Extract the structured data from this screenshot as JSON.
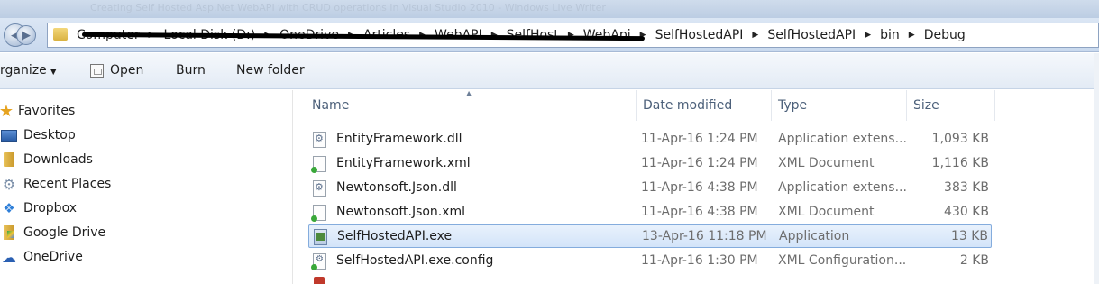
{
  "window": {
    "title": "Creating Self Hosted Asp.Net WebAPI with CRUD operations in Visual Studio 2010 - Windows Live Writer"
  },
  "address": {
    "crumbs_hidden": [
      "Computer",
      "Local Disk (D:)",
      "OneDrive",
      "Articles",
      "WebAPI",
      "SelfHost",
      "WebApi"
    ],
    "crumbs_visible": [
      "SelfHostedAPI",
      "SelfHostedAPI",
      "bin",
      "Debug"
    ]
  },
  "toolbar": {
    "organize": "rganize",
    "open": "Open",
    "burn": "Burn",
    "new_folder": "New folder"
  },
  "nav": {
    "items": [
      {
        "label": "Favorites",
        "icon": "star-icon"
      },
      {
        "label": "Desktop",
        "icon": "desktop-icon"
      },
      {
        "label": "Downloads",
        "icon": "downloads-folder-icon"
      },
      {
        "label": "Recent Places",
        "icon": "recent-places-icon"
      },
      {
        "label": "Dropbox",
        "icon": "dropbox-icon"
      },
      {
        "label": "Google Drive",
        "icon": "google-drive-icon"
      },
      {
        "label": "OneDrive",
        "icon": "onedrive-icon"
      }
    ]
  },
  "columns": {
    "name": "Name",
    "date": "Date modified",
    "type": "Type",
    "size": "Size"
  },
  "files": [
    {
      "name": "EntityFramework.dll",
      "date": "11-Apr-16 1:24 PM",
      "type": "Application extens...",
      "size": "1,093 KB",
      "icon": "dll-file-icon"
    },
    {
      "name": "EntityFramework.xml",
      "date": "11-Apr-16 1:24 PM",
      "type": "XML Document",
      "size": "1,116 KB",
      "icon": "xml-file-icon"
    },
    {
      "name": "Newtonsoft.Json.dll",
      "date": "11-Apr-16 4:38 PM",
      "type": "Application extens...",
      "size": "383 KB",
      "icon": "dll-file-icon"
    },
    {
      "name": "Newtonsoft.Json.xml",
      "date": "11-Apr-16 4:38 PM",
      "type": "XML Document",
      "size": "430 KB",
      "icon": "xml-file-icon"
    },
    {
      "name": "SelfHostedAPI.exe",
      "date": "13-Apr-16 11:18 PM",
      "type": "Application",
      "size": "13 KB",
      "icon": "exe-file-icon",
      "selected": true
    },
    {
      "name": "SelfHostedAPI.exe.config",
      "date": "11-Apr-16 1:30 PM",
      "type": "XML Configuration...",
      "size": "2 KB",
      "icon": "config-file-icon"
    }
  ]
}
